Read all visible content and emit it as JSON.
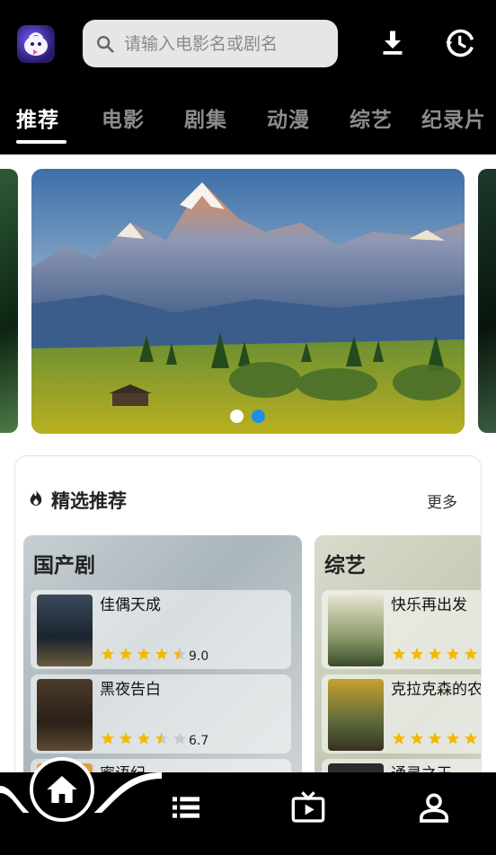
{
  "search": {
    "placeholder": "请输入电影名或剧名"
  },
  "tabs": [
    {
      "label": "推荐",
      "active": true
    },
    {
      "label": "电影",
      "active": false
    },
    {
      "label": "剧集",
      "active": false
    },
    {
      "label": "动漫",
      "active": false
    },
    {
      "label": "综艺",
      "active": false
    },
    {
      "label": "纪录片",
      "active": false
    }
  ],
  "banner": {
    "slide_count": 2,
    "active_slide": 2
  },
  "featured": {
    "title": "精选推荐",
    "more_label": "更多",
    "panels": [
      {
        "title": "国产剧",
        "items": [
          {
            "name": "佳偶天成",
            "rating": 9.0,
            "score": "9.0",
            "stars": 4.5
          },
          {
            "name": "黑夜告白",
            "rating": 6.7,
            "score": "6.7",
            "stars": 3.5
          },
          {
            "name": "蜜语纪",
            "rating": null,
            "score": "",
            "stars": 0
          }
        ]
      },
      {
        "title": "综艺",
        "items": [
          {
            "name": "快乐再出发",
            "rating": null,
            "score": "",
            "stars": 5
          },
          {
            "name": "克拉克森的农",
            "rating": null,
            "score": "",
            "stars": 5
          },
          {
            "name": "通灵之王",
            "rating": null,
            "score": "",
            "stars": 0
          }
        ]
      }
    ]
  },
  "bottom_nav": [
    {
      "icon": "home-icon",
      "active": true
    },
    {
      "icon": "list-icon",
      "active": false
    },
    {
      "icon": "tv-play-icon",
      "active": false
    },
    {
      "icon": "user-icon",
      "active": false
    }
  ],
  "colors": {
    "accent": "#1e8fe6",
    "star": "#f5b800",
    "background": "#000000"
  }
}
